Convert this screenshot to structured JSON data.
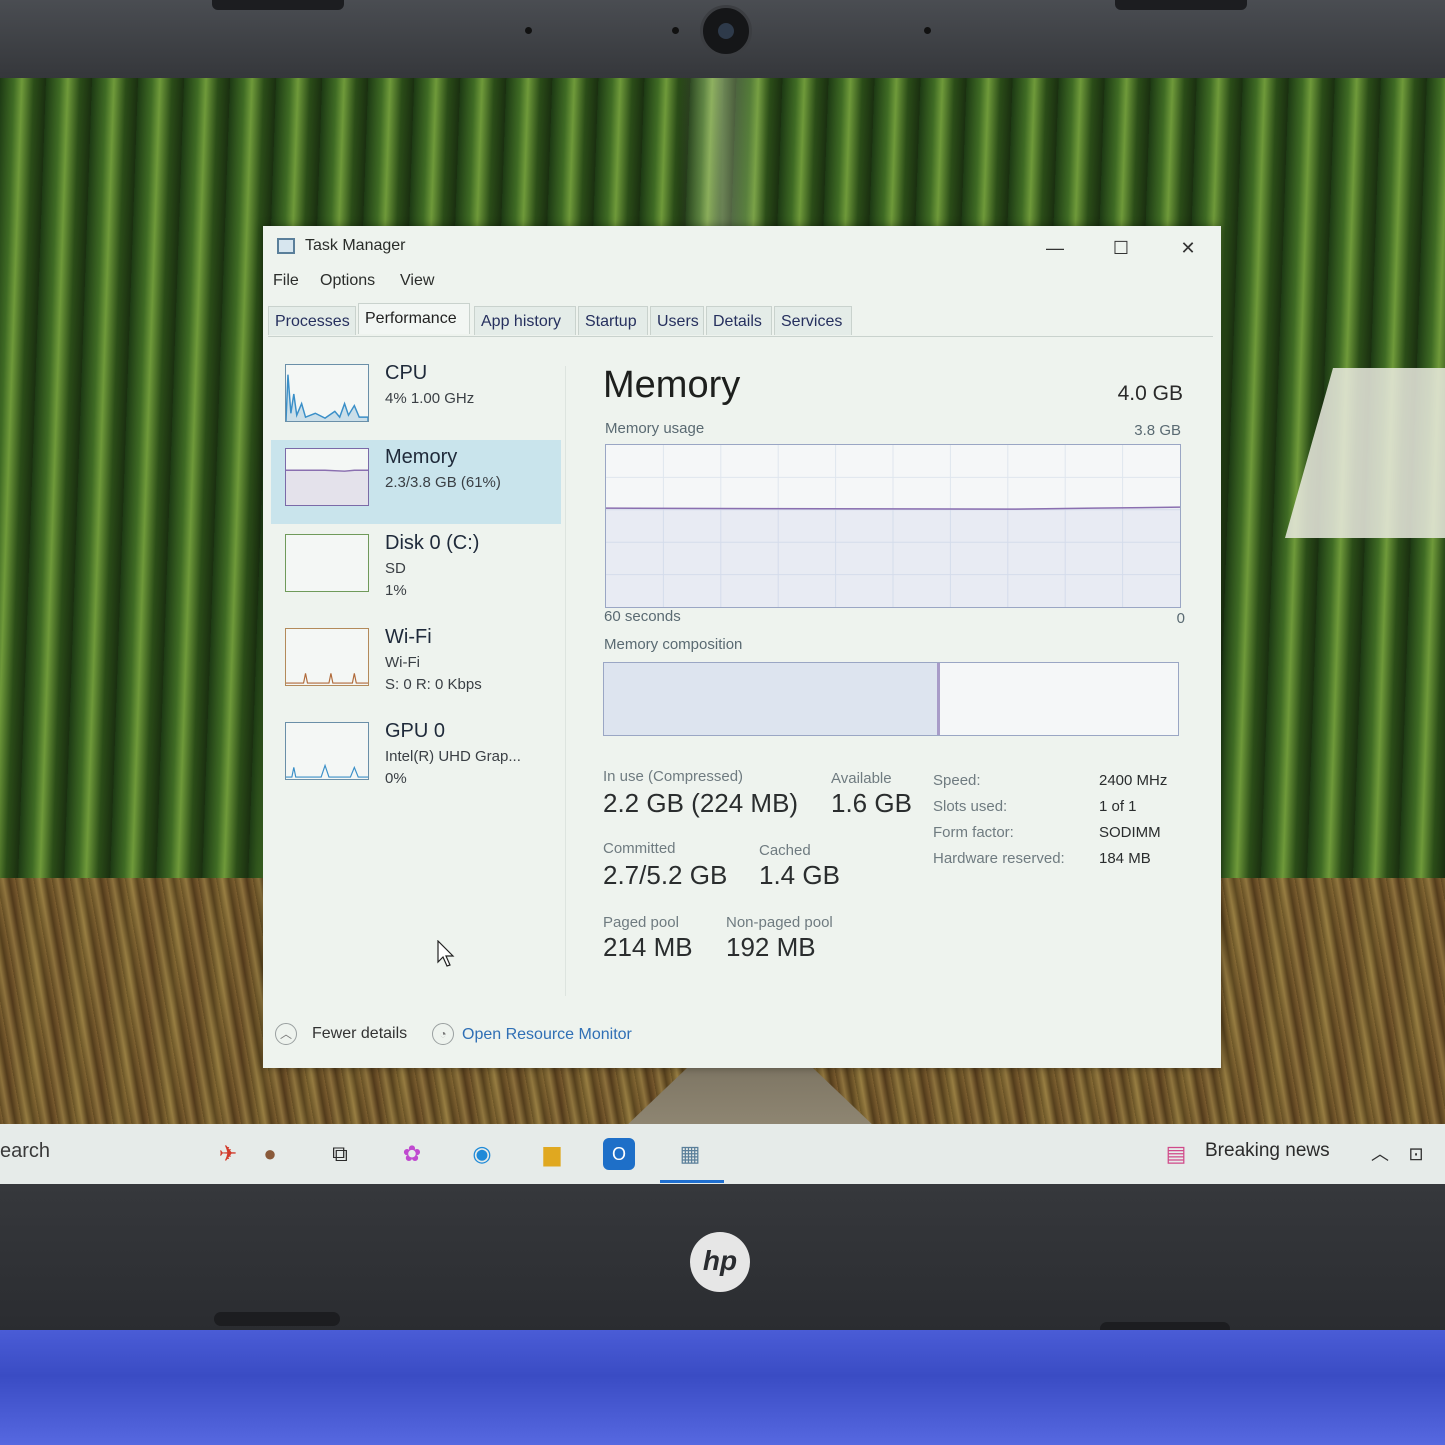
{
  "window": {
    "title": "Task Manager",
    "controls": {
      "minimize": "—",
      "maximize": "☐",
      "close": "✕"
    }
  },
  "menu": [
    "File",
    "Options",
    "View"
  ],
  "tabs": [
    "Processes",
    "Performance",
    "App history",
    "Startup",
    "Users",
    "Details",
    "Services"
  ],
  "active_tab": "Performance",
  "sidebar": [
    {
      "name": "CPU",
      "sub1": "4%  1.00 GHz",
      "sub2": ""
    },
    {
      "name": "Memory",
      "sub1": "2.3/3.8 GB (61%)",
      "sub2": ""
    },
    {
      "name": "Disk 0 (C:)",
      "sub1": "SD",
      "sub2": "1%"
    },
    {
      "name": "Wi-Fi",
      "sub1": "Wi-Fi",
      "sub2": "S: 0  R: 0 Kbps"
    },
    {
      "name": "GPU 0",
      "sub1": "Intel(R) UHD Grap...",
      "sub2": "0%"
    }
  ],
  "memory": {
    "title": "Memory",
    "total": "4.0 GB",
    "usage_label": "Memory usage",
    "usage_max": "3.8 GB",
    "time_span": "60 seconds",
    "time_end": "0",
    "composition_label": "Memory composition",
    "usage_fraction": 0.61,
    "composition": {
      "in_use_fraction": 0.58,
      "available_fraction": 0.42
    },
    "stats": {
      "in_use": {
        "label": "In use (Compressed)",
        "value": "2.2 GB (224 MB)"
      },
      "available": {
        "label": "Available",
        "value": "1.6 GB"
      },
      "committed": {
        "label": "Committed",
        "value": "2.7/5.2 GB"
      },
      "cached": {
        "label": "Cached",
        "value": "1.4 GB"
      },
      "paged_pool": {
        "label": "Paged pool",
        "value": "214 MB"
      },
      "non_paged_pool": {
        "label": "Non-paged pool",
        "value": "192 MB"
      }
    },
    "specs": [
      {
        "label": "Speed:",
        "value": "2400 MHz"
      },
      {
        "label": "Slots used:",
        "value": "1 of 1"
      },
      {
        "label": "Form factor:",
        "value": "SODIMM"
      },
      {
        "label": "Hardware reserved:",
        "value": "184 MB"
      }
    ]
  },
  "footer": {
    "fewer_details": "Fewer details",
    "open_resource_monitor": "Open Resource Monitor"
  },
  "taskbar": {
    "search": "earch",
    "news": "Breaking news"
  },
  "brand": "hp",
  "colors": {
    "accent_link": "#2f6fb5",
    "selected_bg": "#c9e4ec",
    "memory_line": "#8a6fb0"
  }
}
